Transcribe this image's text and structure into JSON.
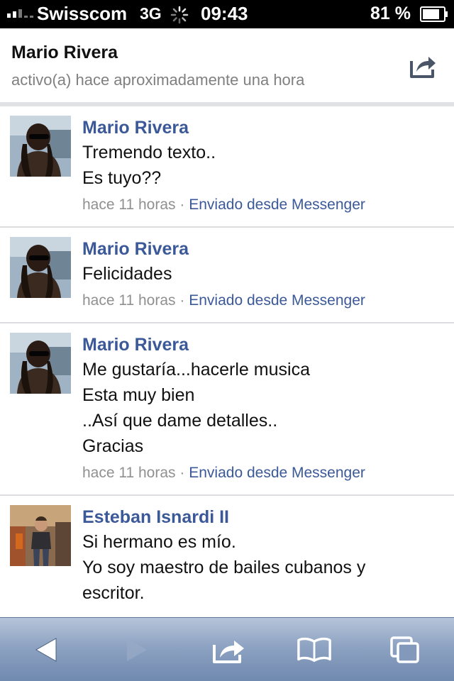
{
  "status_bar": {
    "carrier": "Swisscom",
    "network": "3G",
    "time": "09:43",
    "battery_percent": "81 %",
    "signal_bars": 2
  },
  "header": {
    "name": "Mario Rivera",
    "status": "activo(a) hace aproximadamente una hora",
    "share_icon": "share-icon"
  },
  "messages": [
    {
      "sender": "Mario Rivera",
      "lines": [
        "Tremendo texto..",
        "Es tuyo??"
      ],
      "time": "hace 11 horas",
      "separator": "·",
      "source": "Enviado desde Messenger"
    },
    {
      "sender": "Mario Rivera",
      "lines": [
        "Felicidades"
      ],
      "time": "hace 11 horas",
      "separator": "·",
      "source": "Enviado desde Messenger"
    },
    {
      "sender": "Mario Rivera",
      "lines": [
        "Me gustaría...hacerle musica",
        "Esta muy bien",
        "..Así que dame detalles..",
        "Gracias"
      ],
      "time": "hace 11 horas",
      "separator": "·",
      "source": "Enviado desde Messenger"
    },
    {
      "sender": "Esteban Isnardi II",
      "lines": [
        "Si hermano es mío.",
        "Yo soy maestro de bailes cubanos y",
        "escritor."
      ],
      "time": "",
      "separator": "",
      "source": ""
    }
  ],
  "toolbar": {
    "items": [
      "back-icon",
      "forward-icon",
      "share-icon",
      "bookmarks-icon",
      "tabs-icon"
    ]
  },
  "colors": {
    "link_blue": "#3b5998",
    "meta_gray": "#909090",
    "toolbar_top": "#b6c4d9",
    "toolbar_bottom": "#7089b0"
  }
}
